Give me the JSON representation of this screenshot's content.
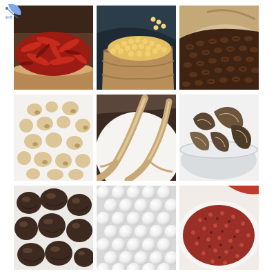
{
  "logo": {
    "text": "好药",
    "icon": "leaf-logo-icon"
  },
  "tiles": [
    {
      "name": "dried-red-chili"
    },
    {
      "name": "soybeans"
    },
    {
      "name": "coffee-beans"
    },
    {
      "name": "dried-ginger"
    },
    {
      "name": "ginseng-roots"
    },
    {
      "name": "dried-mushrooms-in-bowl"
    },
    {
      "name": "maca-roots"
    },
    {
      "name": "white-pearls"
    },
    {
      "name": "sichuan-pepper"
    }
  ]
}
